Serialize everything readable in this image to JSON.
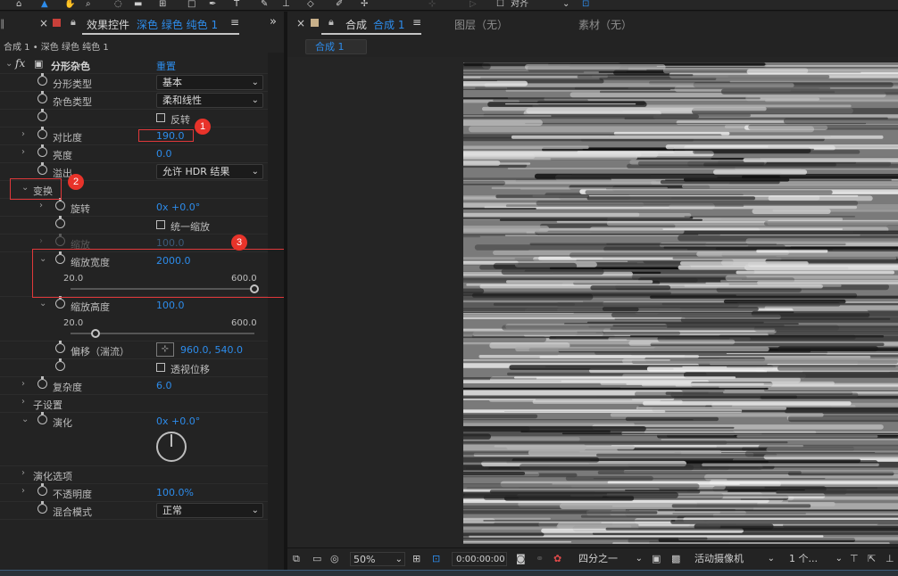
{
  "left_panel": {
    "tab_title": "效果控件",
    "tab_layer": "深色 绿色 纯色 1",
    "breadcrumb": "合成 1 • 深色 绿色 纯色 1",
    "effect": {
      "name": "分形杂色",
      "reset": "重置",
      "fx": "fx",
      "props": {
        "fractal_type": {
          "label": "分形类型",
          "value": "基本"
        },
        "noise_type": {
          "label": "杂色类型",
          "value": "柔和线性"
        },
        "invert": {
          "label": "反转"
        },
        "contrast": {
          "label": "对比度",
          "value": "190.0"
        },
        "brightness": {
          "label": "亮度",
          "value": "0.0"
        },
        "overflow": {
          "label": "溢出",
          "value": "允许 HDR 结果"
        },
        "transform": {
          "label": "变换"
        },
        "rotation": {
          "label": "旋转",
          "value": "0x +0.0°"
        },
        "uniform_scale": {
          "label": "统一缩放"
        },
        "scale": {
          "label": "缩放",
          "value": "100.0"
        },
        "scale_width": {
          "label": "缩放宽度",
          "value": "2000.0",
          "min": "20.0",
          "max": "600.0",
          "fraction": 1.0
        },
        "scale_height": {
          "label": "缩放高度",
          "value": "100.0",
          "min": "20.0",
          "max": "600.0",
          "fraction": 0.138
        },
        "offset": {
          "label": "偏移（湍流）",
          "value": "960.0, 540.0"
        },
        "perspective": {
          "label": "透视位移"
        },
        "complexity": {
          "label": "复杂度",
          "value": "6.0"
        },
        "sub_settings": {
          "label": "子设置"
        },
        "evolution": {
          "label": "演化",
          "value": "0x +0.0°"
        },
        "evolution_options": {
          "label": "演化选项"
        },
        "opacity": {
          "label": "不透明度",
          "value": "100.0%"
        },
        "blend_mode": {
          "label": "混合模式",
          "value": "正常"
        }
      }
    },
    "annotations": [
      "1",
      "2",
      "3"
    ]
  },
  "right_panel": {
    "tab_title": "合成",
    "tab_comp": "合成 1",
    "tab_layer": "图层（无）",
    "tab_footage": "素材（无）",
    "sub_tab": "合成 1",
    "toolbar_snap": "对齐"
  },
  "bottom_bar": {
    "zoom": "50%",
    "timecode": "0:00:00:00",
    "resolution": "四分之一",
    "camera": "活动摄像机",
    "views": "1 个..."
  },
  "colors": {
    "accent": "#2d8ceb",
    "annotation": "#e8332a",
    "panel": "#232323"
  }
}
